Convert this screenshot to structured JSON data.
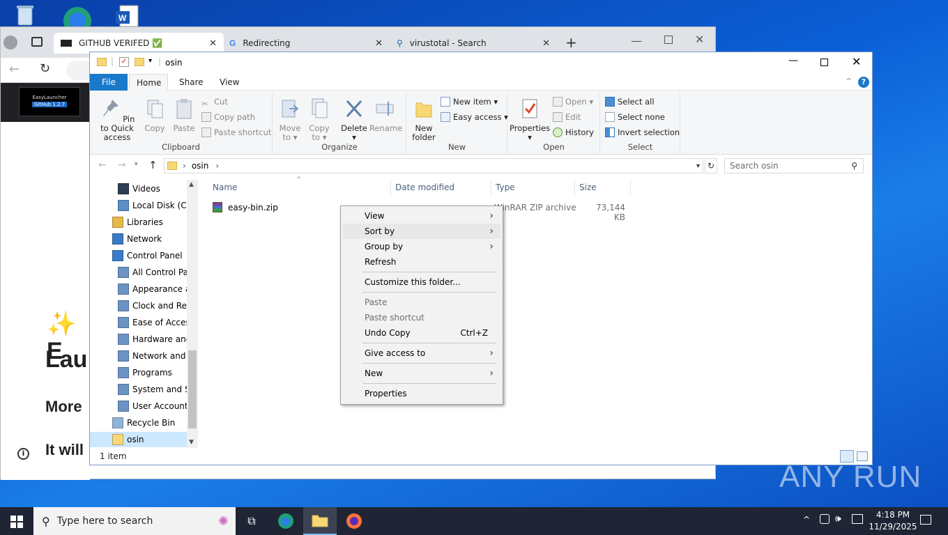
{
  "browser": {
    "tabs": [
      {
        "label": "GITHUB VERIFED ✅",
        "icon": "github-favicon"
      },
      {
        "label": "Redirecting",
        "icon": "google-favicon"
      },
      {
        "label": "virustotal - Search",
        "icon": "search-favicon"
      }
    ],
    "new_tab": "+",
    "page_fragments": {
      "heading_1": "✨ E",
      "heading_2": "Lau",
      "subheading": "More",
      "line": "It will"
    },
    "sidebar_thumb": {
      "line1": "EasyLauncher",
      "line2": "GitHub 1.2.7"
    }
  },
  "explorer": {
    "title": "osin",
    "ribbon_tabs": [
      "File",
      "Home",
      "Share",
      "View"
    ],
    "ribbon": {
      "clipboard": {
        "label": "Clipboard",
        "pin": "Pin to Quick access",
        "copy": "Copy",
        "paste": "Paste",
        "cut": "Cut",
        "copy_path": "Copy path",
        "paste_shortcut": "Paste shortcut"
      },
      "organize": {
        "label": "Organize",
        "move_to": "Move to",
        "copy_to": "Copy to",
        "delete": "Delete",
        "rename": "Rename"
      },
      "new": {
        "label": "New",
        "new_folder": "New folder",
        "new_item": "New item",
        "easy_access": "Easy access"
      },
      "open": {
        "label": "Open",
        "properties": "Properties",
        "open": "Open",
        "edit": "Edit",
        "history": "History"
      },
      "select": {
        "label": "Select",
        "select_all": "Select all",
        "select_none": "Select none",
        "invert": "Invert selection"
      }
    },
    "address": {
      "crumb": "osin"
    },
    "search_placeholder": "Search osin",
    "nav": [
      {
        "label": "Videos",
        "indent": 1
      },
      {
        "label": "Local Disk (C:)",
        "indent": 1
      },
      {
        "label": "Libraries",
        "indent": 0
      },
      {
        "label": "Network",
        "indent": 0
      },
      {
        "label": "Control Panel",
        "indent": 0
      },
      {
        "label": "All Control Panel Items",
        "indent": 1
      },
      {
        "label": "Appearance and Personalization",
        "indent": 1
      },
      {
        "label": "Clock and Region",
        "indent": 1
      },
      {
        "label": "Ease of Access",
        "indent": 1
      },
      {
        "label": "Hardware and Sound",
        "indent": 1
      },
      {
        "label": "Network and Internet",
        "indent": 1
      },
      {
        "label": "Programs",
        "indent": 1
      },
      {
        "label": "System and Security",
        "indent": 1
      },
      {
        "label": "User Accounts",
        "indent": 1
      },
      {
        "label": "Recycle Bin",
        "indent": 0
      },
      {
        "label": "osin",
        "indent": 0,
        "selected": true
      }
    ],
    "columns": [
      "Name",
      "Date modified",
      "Type",
      "Size"
    ],
    "files": [
      {
        "name": "easy-bin.zip",
        "type": "WinRAR ZIP archive",
        "size": "73,144 KB"
      }
    ],
    "status": "1 item"
  },
  "context_menu": {
    "items": [
      {
        "label": "View",
        "submenu": true
      },
      {
        "label": "Sort by",
        "submenu": true,
        "hover": true
      },
      {
        "label": "Group by",
        "submenu": true
      },
      {
        "label": "Refresh"
      },
      {
        "sep": true
      },
      {
        "label": "Customize this folder..."
      },
      {
        "sep": true
      },
      {
        "label": "Paste",
        "disabled": true
      },
      {
        "label": "Paste shortcut",
        "disabled": true
      },
      {
        "label": "Undo Copy",
        "shortcut": "Ctrl+Z"
      },
      {
        "sep": true
      },
      {
        "label": "Give access to",
        "submenu": true
      },
      {
        "sep": true
      },
      {
        "label": "New",
        "submenu": true
      },
      {
        "sep": true
      },
      {
        "label": "Properties"
      }
    ]
  },
  "taskbar": {
    "search_placeholder": "Type here to search",
    "time": "4:18 PM",
    "date": "11/29/2025"
  },
  "watermark": "ANY RUN"
}
